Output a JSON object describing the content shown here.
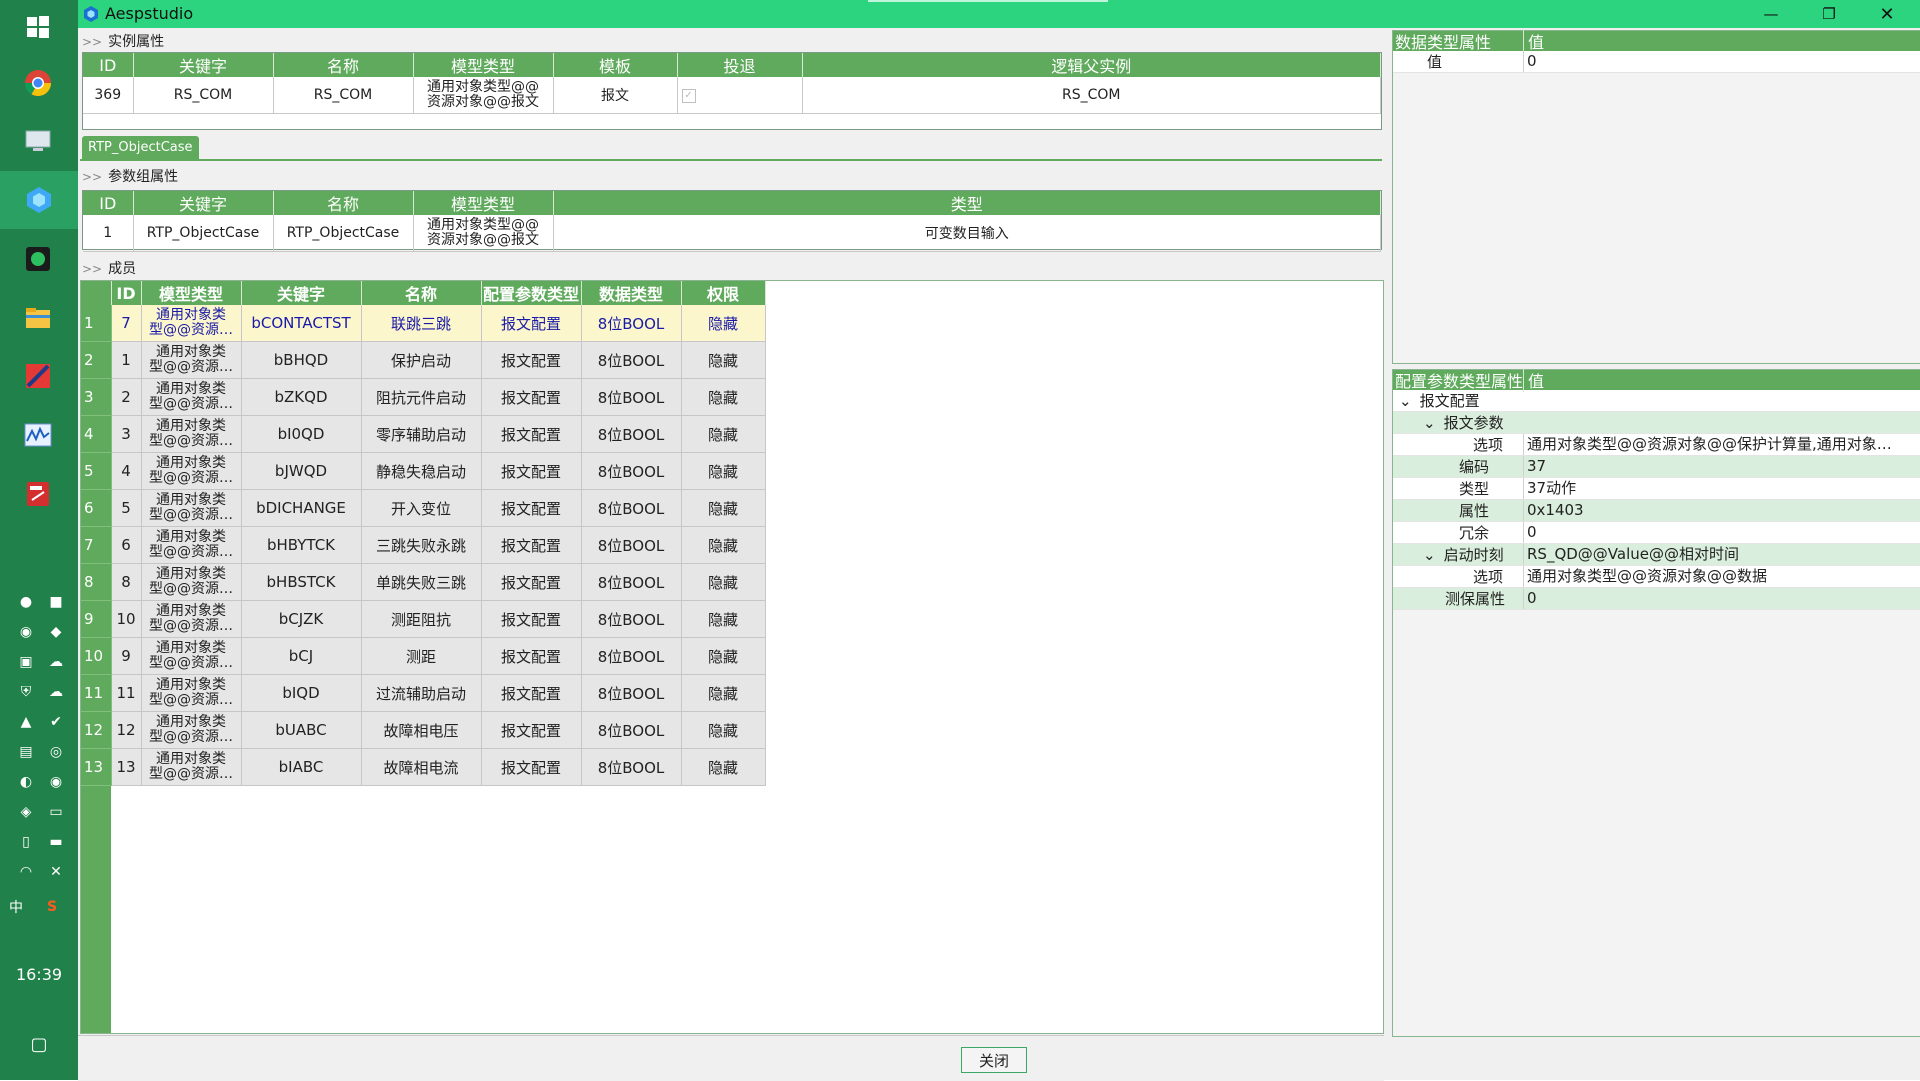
{
  "window": {
    "title": "Aespstudio",
    "close_label": "关闭"
  },
  "taskbar": {
    "clock": "16:39"
  },
  "instance": {
    "section_label": "实例属性",
    "columns": [
      "ID",
      "关键字",
      "名称",
      "模型类型",
      "模板",
      "投退",
      "逻辑父实例"
    ],
    "row": {
      "id": "369",
      "key": "RS_COM",
      "name": "RS_COM",
      "type_l1": "通用对象类型@@",
      "type_l2": "资源对象@@报文",
      "template": "报文",
      "toggle_checked": true,
      "parent": "RS_COM"
    }
  },
  "tab": {
    "label": "RTP_ObjectCase"
  },
  "param_group": {
    "section_label": "参数组属性",
    "columns": [
      "ID",
      "关键字",
      "名称",
      "模型类型",
      "类型"
    ],
    "row": {
      "id": "1",
      "key": "RTP_ObjectCase",
      "name": "RTP_ObjectCase",
      "type_l1": "通用对象类型@@",
      "type_l2": "资源对象@@报文",
      "kind": "可变数目输入"
    }
  },
  "members": {
    "section_label": "成员",
    "columns": [
      "ID",
      "模型类型",
      "关键字",
      "名称",
      "配置参数类型",
      "数据类型",
      "权限"
    ],
    "model_l1": "通用对象类",
    "model_l2": "型@@资源…",
    "config_type": "报文配置",
    "data_type": "8位BOOL",
    "permission": "隐藏",
    "rows": [
      {
        "row": "1",
        "id": "7",
        "key": "bCONTACTST",
        "name": "联跳三跳",
        "selected": true
      },
      {
        "row": "2",
        "id": "1",
        "key": "bBHQD",
        "name": "保护启动"
      },
      {
        "row": "3",
        "id": "2",
        "key": "bZKQD",
        "name": "阻抗元件启动"
      },
      {
        "row": "4",
        "id": "3",
        "key": "bI0QD",
        "name": "零序辅助启动"
      },
      {
        "row": "5",
        "id": "4",
        "key": "bJWQD",
        "name": "静稳失稳启动"
      },
      {
        "row": "6",
        "id": "5",
        "key": "bDICHANGE",
        "name": "开入变位"
      },
      {
        "row": "7",
        "id": "6",
        "key": "bHBYTCK",
        "name": "三跳失败永跳"
      },
      {
        "row": "8",
        "id": "8",
        "key": "bHBSTCK",
        "name": "单跳失败三跳"
      },
      {
        "row": "9",
        "id": "10",
        "key": "bCJZK",
        "name": "测距阻抗"
      },
      {
        "row": "10",
        "id": "9",
        "key": "bCJ",
        "name": "测距"
      },
      {
        "row": "11",
        "id": "11",
        "key": "bIQD",
        "name": "过流辅助启动"
      },
      {
        "row": "12",
        "id": "12",
        "key": "bUABC",
        "name": "故障相电压"
      },
      {
        "row": "13",
        "id": "13",
        "key": "bIABC",
        "name": "故障相电流"
      }
    ]
  },
  "datatype_props": {
    "headers": [
      "数据类型属性",
      "值"
    ],
    "rows": [
      {
        "key": "值",
        "value": "0"
      }
    ]
  },
  "config_props": {
    "headers": [
      "配置参数类型属性",
      "值"
    ],
    "root": "报文配置",
    "group1": "报文参数",
    "g1_rows": [
      {
        "key": "选项",
        "value": "通用对象类型@@资源对象@@保护计算量,通用对象…"
      },
      {
        "key": "编码",
        "value": "37"
      },
      {
        "key": "类型",
        "value": "37动作"
      },
      {
        "key": "属性",
        "value": "0x1403"
      },
      {
        "key": "冗余",
        "value": "0"
      }
    ],
    "group2": {
      "key": "启动时刻",
      "value": "RS_QD@@Value@@相对时间"
    },
    "g2_rows": [
      {
        "key": "选项",
        "value": "通用对象类型@@资源对象@@数据"
      }
    ],
    "tail": {
      "key": "测保属性",
      "value": "0"
    }
  },
  "colors": {
    "accent": "#2dd47f",
    "header": "#5faa5c",
    "taskbar": "#21814a",
    "selected_row": "#fbf6cc"
  }
}
